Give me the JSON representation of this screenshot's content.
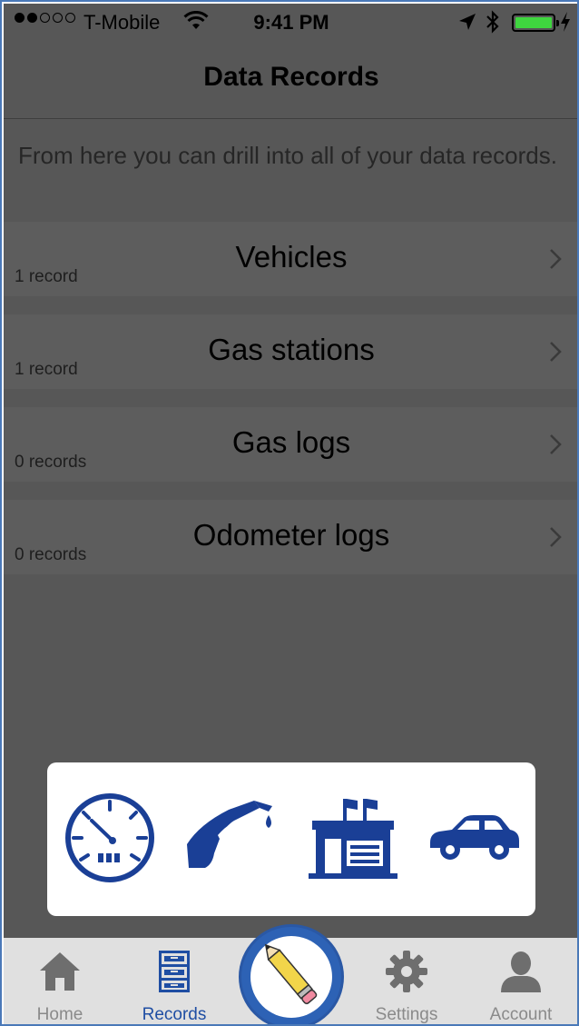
{
  "status_bar": {
    "carrier": "T-Mobile",
    "time": "9:41 PM",
    "battery_color": "#3fd63f"
  },
  "nav": {
    "title": "Data Records"
  },
  "intro_text": "From here you can drill into all of your data records.",
  "records": [
    {
      "title": "Vehicles",
      "count": "1 record"
    },
    {
      "title": "Gas stations",
      "count": "1 record"
    },
    {
      "title": "Gas logs",
      "count": "0 records"
    },
    {
      "title": "Odometer logs",
      "count": "0 records"
    }
  ],
  "quick_actions": [
    {
      "icon": "odometer-icon"
    },
    {
      "icon": "fuel-pump-nozzle-icon"
    },
    {
      "icon": "gas-station-icon"
    },
    {
      "icon": "car-icon"
    }
  ],
  "tabs": [
    {
      "label": "Home",
      "icon": "home-icon"
    },
    {
      "label": "Records",
      "icon": "file-cabinet-icon",
      "active": true
    },
    {
      "label": "Settings",
      "icon": "gear-icon"
    },
    {
      "label": "Account",
      "icon": "person-icon"
    }
  ],
  "center_action": {
    "icon": "pencil-icon"
  },
  "colors": {
    "accent": "#1f4ea3",
    "overlay": "#575757",
    "icon_blue": "#1a3f96"
  }
}
